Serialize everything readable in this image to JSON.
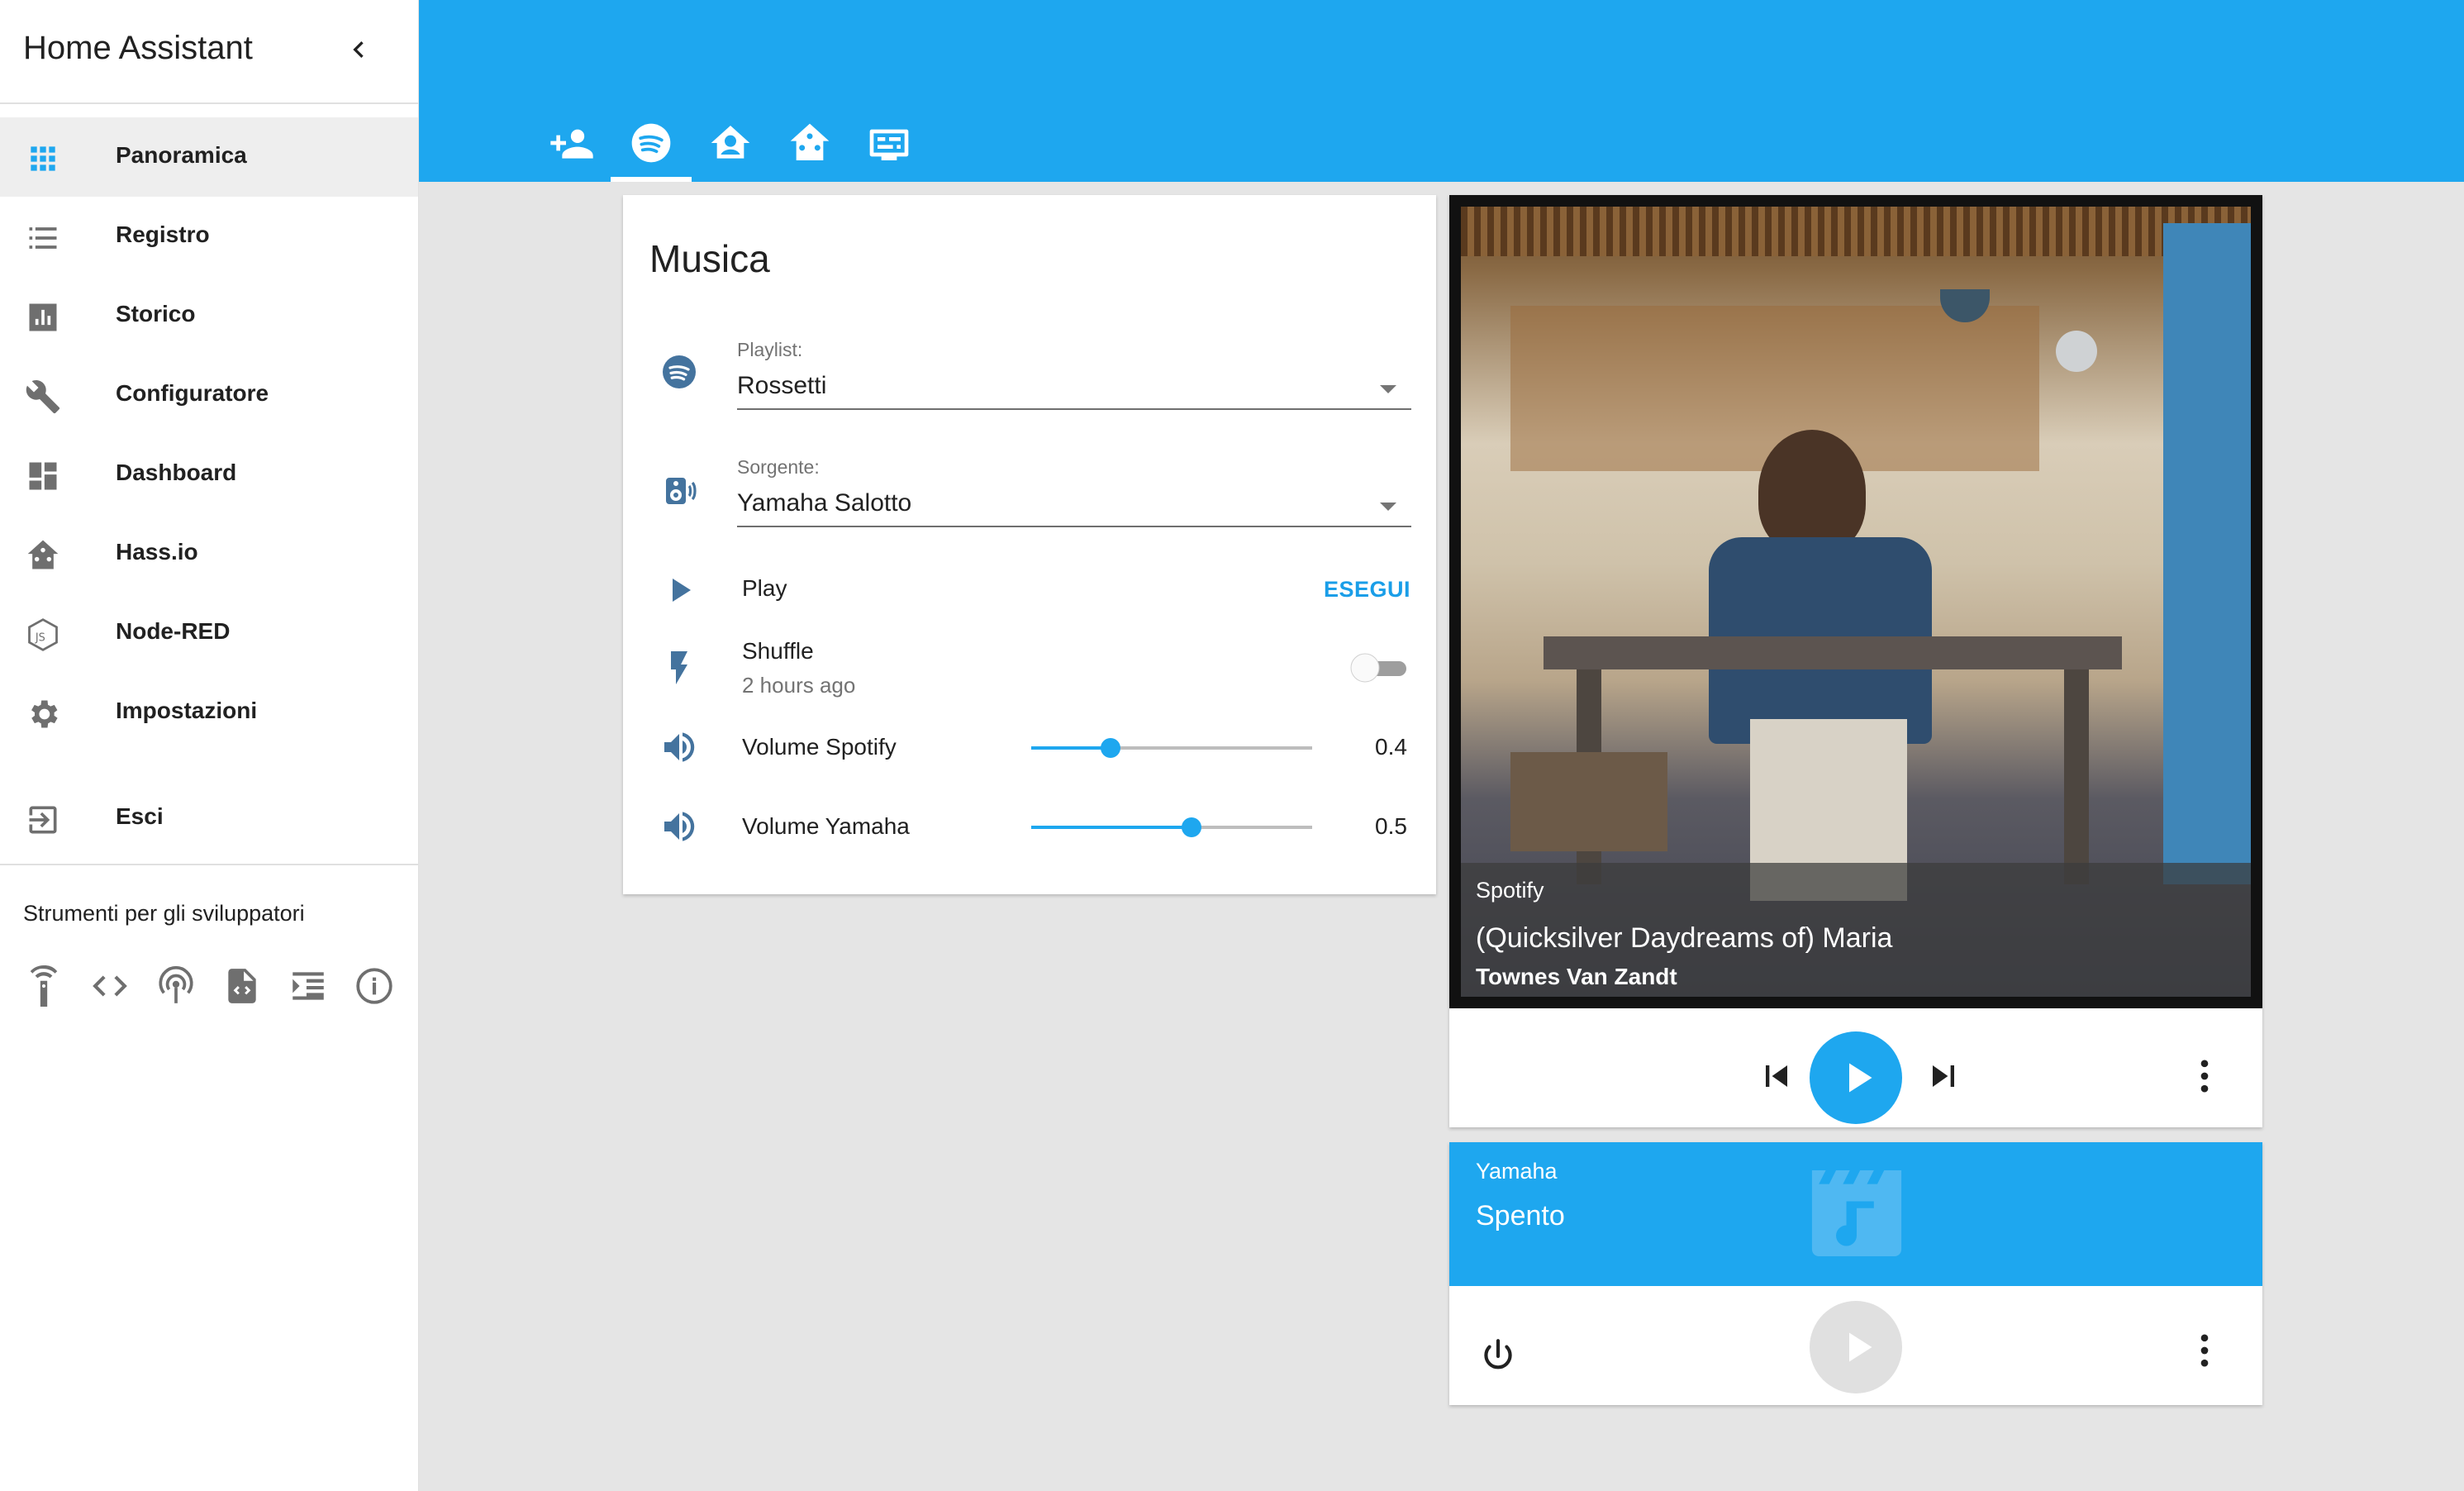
{
  "sidebar": {
    "title": "Home Assistant",
    "items": [
      {
        "label": "Panoramica",
        "icon": "apps-icon",
        "active": true
      },
      {
        "label": "Registro",
        "icon": "list-icon"
      },
      {
        "label": "Storico",
        "icon": "chart-icon"
      },
      {
        "label": "Configuratore",
        "icon": "wrench-icon"
      },
      {
        "label": "Dashboard",
        "icon": "dashboard-icon"
      },
      {
        "label": "Hass.io",
        "icon": "hassio-icon"
      },
      {
        "label": "Node-RED",
        "icon": "nodejs-icon"
      },
      {
        "label": "Impostazioni",
        "icon": "gear-icon"
      },
      {
        "label": "Esci",
        "icon": "exit-icon"
      }
    ],
    "dev_tools_title": "Strumenti per gli sviluppatori",
    "dev_tools": [
      "remote-icon",
      "code-icon",
      "broadcast-icon",
      "file-code-icon",
      "log-icon",
      "info-icon"
    ]
  },
  "header": {
    "tabs": [
      "account-group-icon",
      "spotify-icon",
      "home-icon",
      "home-assistant-icon",
      "tv-guide-icon"
    ],
    "active_tab": 1,
    "color": "#1ea7ef"
  },
  "musica": {
    "title": "Musica",
    "playlist_label": "Playlist:",
    "playlist_value": "Rossetti",
    "source_label": "Sorgente:",
    "source_value": "Yamaha Salotto",
    "play_label": "Play",
    "play_action": "ESEGUI",
    "shuffle_label": "Shuffle",
    "shuffle_time": "2 hours ago",
    "shuffle_on": false,
    "volume_spotify_label": "Volume Spotify",
    "volume_spotify_value": "0.4",
    "volume_yamaha_label": "Volume Yamaha",
    "volume_yamaha_value": "0.5"
  },
  "spotify": {
    "source": "Spotify",
    "title": "(Quicksilver Daydreams of) Maria",
    "artist": "Townes Van Zandt"
  },
  "yamaha": {
    "source": "Yamaha",
    "state": "Spento"
  }
}
